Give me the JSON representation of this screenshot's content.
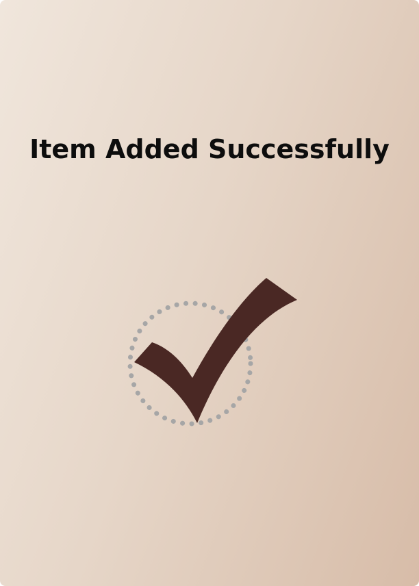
{
  "dialog": {
    "title": "Item Added Successfully"
  },
  "icons": {
    "status": "check-mark-icon",
    "badge": "dotted-circle-icon"
  },
  "colors": {
    "title_text": "#0d0d0d",
    "check_mark": "#4a2824",
    "dotted_ring": "#a6a6a6",
    "background_start": "#f0e6dc",
    "background_end": "#d7bca8"
  }
}
